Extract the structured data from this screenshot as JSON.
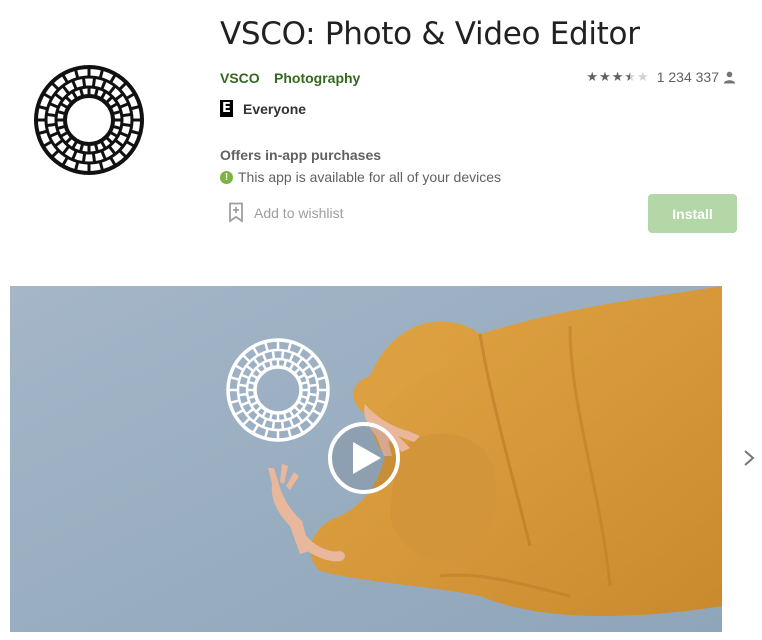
{
  "app": {
    "title": "VSCO: Photo & Video Editor",
    "developer": "VSCO",
    "category": "Photography",
    "content_rating": "Everyone",
    "content_rating_badge": "E",
    "rating_stars": 3.5,
    "rating_count": "1 234 337",
    "in_app_purchases": "Offers in-app purchases",
    "info_badge": "!",
    "availability": "This app is available for all of your devices",
    "wishlist_label": "Add to wishlist",
    "install_label": "Install"
  },
  "colors": {
    "accent_green": "#33691e",
    "install_bg": "#b3d7a6",
    "info_green": "#7cb342",
    "hero_sky": "#9aaec1",
    "coat_orange": "#d99a3a"
  },
  "icons": {
    "app_icon": "vsco-logo-icon",
    "rating_person": "person-icon",
    "wishlist": "bookmark-plus-icon",
    "video_play": "play-icon",
    "next": "chevron-right-icon"
  }
}
